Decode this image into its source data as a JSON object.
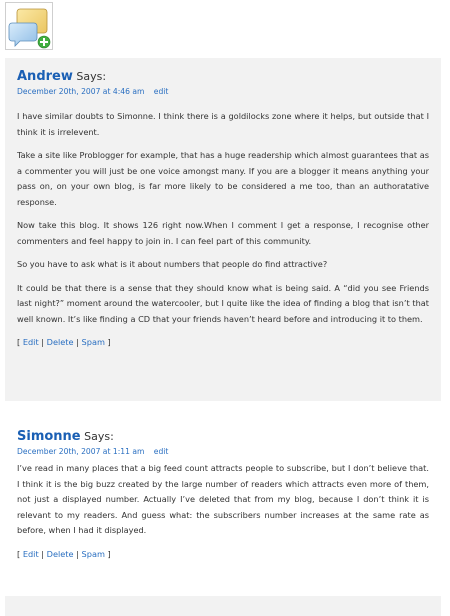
{
  "comments": [
    {
      "author": "Andrew",
      "says": "Says:",
      "date": "December 20th, 2007 at 4:46 am",
      "edit_link": "edit",
      "paragraphs": [
        "I have similar doubts to Simonne. I think there is a goldilocks zone where it helps, but outside that I think it is irrelevent.",
        "Take a site like Problogger for example, that has a huge readership which almost guarantees that as a commenter you will just be one voice amongst many. If you are a blogger it means anything your pass on, on your own blog, is far more likely to be considered a me too, than an authoratative response.",
        "Now take this blog. It shows 126 right now.When I comment I get a response, I recognise other commenters and feel happy to join in. I can feel part of this community.",
        "So you have to ask what is it about numbers that people do find attractive?",
        "It could be that there is a sense that they should know what is being said. A “did you see Friends last night?” moment around the watercooler, but I quite like the idea of finding a blog that isn’t that well known. It’s like finding a CD that your friends haven’t heard before and introducing it to them."
      ],
      "actions": {
        "open": "[",
        "edit": "Edit",
        "sep1": "|",
        "delete": "Delete",
        "sep2": "|",
        "spam": "Spam",
        "close": "]"
      }
    },
    {
      "author": "Simonne",
      "says": "Says:",
      "date": "December 20th, 2007 at 1:11 am",
      "edit_link": "edit",
      "paragraphs": [
        "I’ve read in many places that a big feed count attracts people to subscribe, but I don’t believe that. I think it is the big buzz created by the large number of readers which attracts even more of them, not just a displayed number. Actually I’ve deleted that from my blog, because I don’t think it is relevant to my readers. And guess what: the subscribers number increases at the same rate as before, when I had it displayed."
      ],
      "actions": {
        "open": "[",
        "edit": "Edit",
        "sep1": "|",
        "delete": "Delete",
        "sep2": "|",
        "spam": "Spam",
        "close": "]"
      }
    }
  ],
  "colors": {
    "author": "#1a5fb4",
    "link": "#2a6fc1",
    "comment_bg": "#f2f2f2"
  },
  "icons": {
    "avatar": "comment-bubbles-add-icon"
  }
}
